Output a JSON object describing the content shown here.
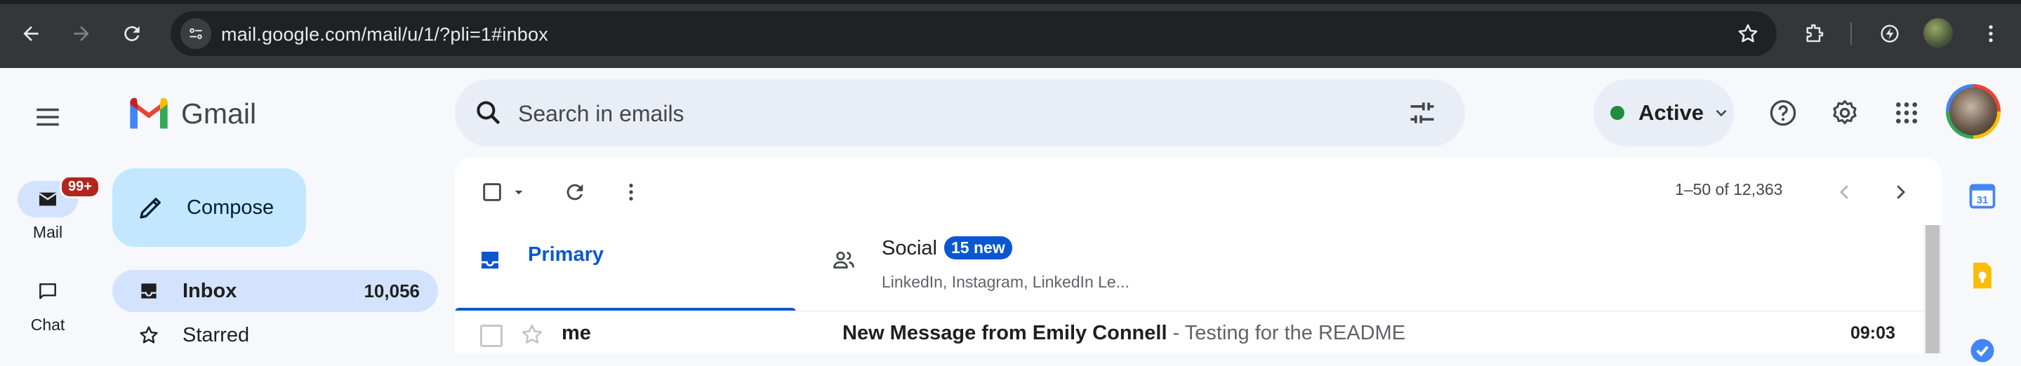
{
  "browser": {
    "url": "mail.google.com/mail/u/1/?pli=1#inbox",
    "icons": [
      "back-icon",
      "forward-icon",
      "reload-icon",
      "site-info-icon",
      "bookmark-star-icon",
      "extensions-icon",
      "performance-icon",
      "profile-avatar",
      "more-icon"
    ]
  },
  "gmail": {
    "logo_text": "Gmail",
    "rail": {
      "mail_label": "Mail",
      "mail_badge": "99+",
      "chat_label": "Chat"
    },
    "compose_label": "Compose",
    "nav": [
      {
        "label": "Inbox",
        "count": "10,056",
        "icon": "inbox-icon"
      },
      {
        "label": "Starred",
        "count": "",
        "icon": "star-icon"
      }
    ],
    "search": {
      "placeholder": "Search in emails"
    },
    "status": {
      "label": "Active",
      "color": "#1e8e3e"
    },
    "toolbar": {
      "page_count": "1–50 of 12,363"
    },
    "tabs": [
      {
        "label": "Primary",
        "icon": "inbox-icon"
      },
      {
        "label": "Social",
        "badge": "15 new",
        "subtitle": "LinkedIn, Instagram, LinkedIn Le...",
        "icon": "people-icon"
      }
    ],
    "emails": [
      {
        "sender": "me",
        "subject": "New Message from Emily Connell",
        "snippet": " - Testing for the README",
        "time": "09:03"
      }
    ]
  },
  "colors": {
    "accent": "#0b57d0",
    "compose_bg": "#c2e7ff",
    "active_nav_bg": "#d3e3fd",
    "badge_red": "#b3261e"
  }
}
